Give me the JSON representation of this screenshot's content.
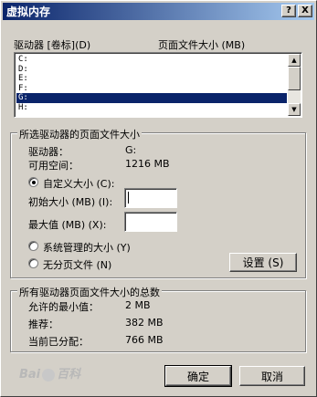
{
  "window": {
    "title": "虚拟内存",
    "help_button": "?",
    "close_button": "X"
  },
  "drives_list": {
    "header_drive": "驱动器 [卷标](D)",
    "header_size": "页面文件大小 (MB)",
    "items": [
      "C:",
      "D:",
      "E:",
      "F:",
      "G:",
      "H:"
    ],
    "selected": "G:"
  },
  "selected_drive": {
    "group_title": "所选驱动器的页面文件大小",
    "drive_label": "驱动器：",
    "drive_value": "G:",
    "space_label": "可用空间：",
    "space_value": "1216 MB",
    "custom_size_label": "自定义大小 (C):",
    "initial_label": "初始大小 (MB) (I):",
    "initial_value": "",
    "max_label": "最大值 (MB) (X):",
    "max_value": "",
    "system_managed_label": "系统管理的大小 (Y)",
    "no_paging_label": "无分页文件 (N)",
    "set_button": "设置 (S)",
    "selected_option": "custom"
  },
  "totals": {
    "group_title": "所有驱动器页面文件大小的总数",
    "min_label": "允许的最小值：",
    "min_value": "2 MB",
    "recommended_label": "推荐：",
    "recommended_value": "382 MB",
    "current_label": "当前已分配：",
    "current_value": "766 MB"
  },
  "buttons": {
    "ok": "确定",
    "cancel": "取消"
  },
  "watermark": {
    "text_left": "Bai",
    "text_right": "百科"
  }
}
